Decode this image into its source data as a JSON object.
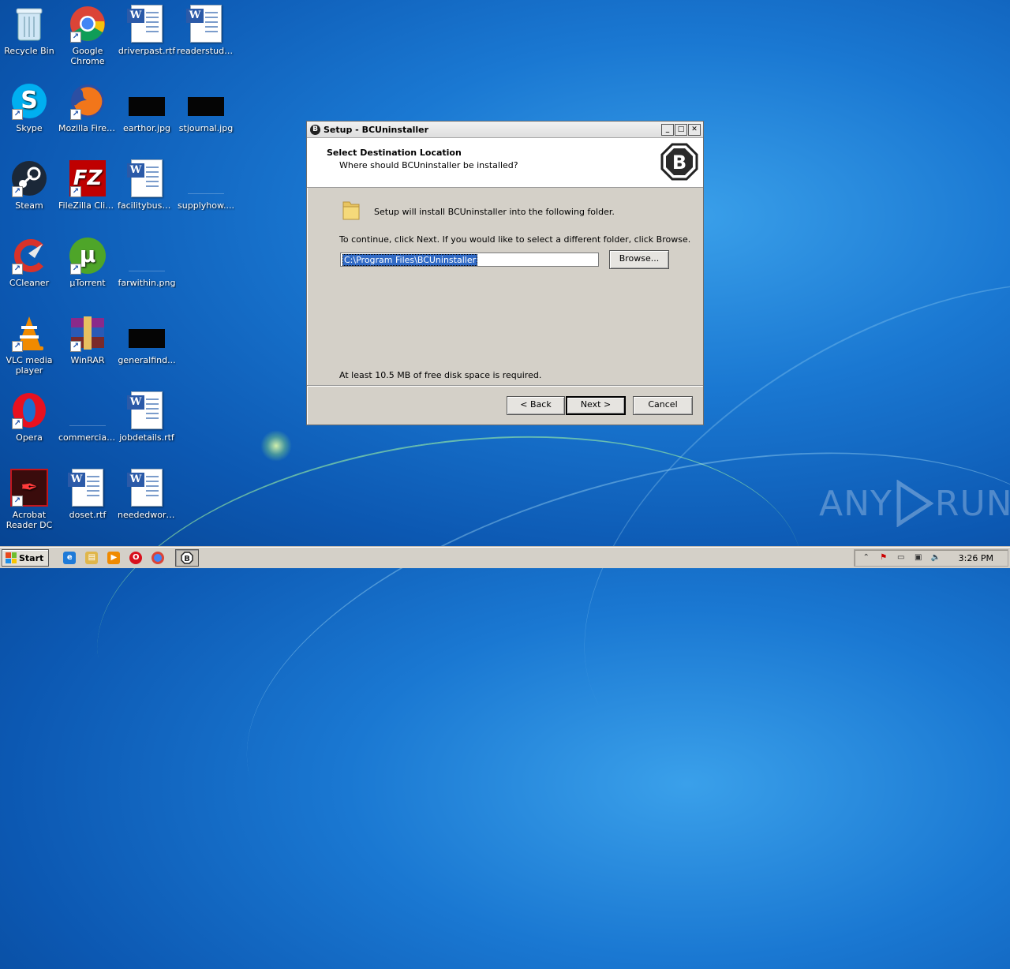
{
  "desktop": {
    "icons": [
      {
        "label": "Recycle Bin"
      },
      {
        "label": "Google Chrome"
      },
      {
        "label": "driverpast.rtf"
      },
      {
        "label": "readerstudy...."
      },
      {
        "label": "Skype"
      },
      {
        "label": "Mozilla Firefox"
      },
      {
        "label": "earthor.jpg"
      },
      {
        "label": "stjournal.jpg"
      },
      {
        "label": "Steam"
      },
      {
        "label": "FileZilla Client"
      },
      {
        "label": "facilitybush.rtf"
      },
      {
        "label": "supplyhow...."
      },
      {
        "label": "CCleaner"
      },
      {
        "label": "µTorrent"
      },
      {
        "label": "farwithin.png"
      },
      {
        "label": "VLC media player"
      },
      {
        "label": "WinRAR"
      },
      {
        "label": "generalfind..."
      },
      {
        "label": "Opera"
      },
      {
        "label": "commercial..."
      },
      {
        "label": "jobdetails.rtf"
      },
      {
        "label": "Acrobat Reader DC"
      },
      {
        "label": "doset.rtf"
      },
      {
        "label": "neededworl..."
      }
    ]
  },
  "dialog": {
    "title": "Setup - BCUninstaller",
    "header_title": "Select Destination Location",
    "header_subtitle": "Where should BCUninstaller be installed?",
    "logo_letter": "B",
    "install_text": "Setup will install BCUninstaller into the following folder.",
    "continue_text": "To continue, click Next. If you would like to select a different folder, click Browse.",
    "path_value": "C:\\Program Files\\BCUninstaller",
    "browse_label": "Browse...",
    "disk_space_text": "At least 10.5 MB of free disk space is required.",
    "back_label": "< Back",
    "next_label": "Next >",
    "cancel_label": "Cancel"
  },
  "taskbar": {
    "start_label": "Start",
    "clock": "3:26 PM"
  },
  "watermark": {
    "left": "ANY",
    "right": "RUN"
  }
}
